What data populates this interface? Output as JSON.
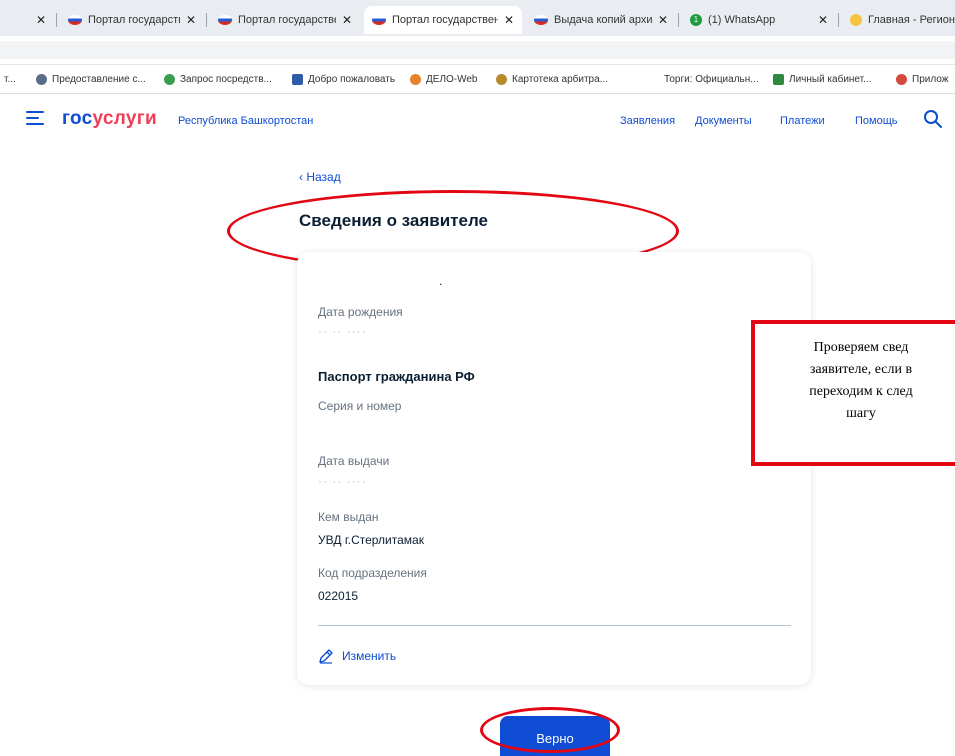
{
  "browser": {
    "tabs": [
      {
        "title": "",
        "icon": "tab-icon",
        "closable": true
      },
      {
        "title": "Портал государствен",
        "icon": "russian-flag-icon",
        "closable": true
      },
      {
        "title": "Портал государствен",
        "icon": "russian-flag-icon",
        "closable": true
      },
      {
        "title": "Портал государствен",
        "icon": "russian-flag-icon",
        "closable": true,
        "active": true
      },
      {
        "title": "Выдача копий архивн",
        "icon": "russian-flag-icon",
        "closable": true
      },
      {
        "title": "(1) WhatsApp",
        "icon": "whatsapp-icon",
        "closable": true
      },
      {
        "title": "Главная - Региона",
        "icon": "smile-icon",
        "closable": false
      }
    ],
    "bookmarks": [
      {
        "label": "т...",
        "icon": ""
      },
      {
        "label": "Предоставление с...",
        "icon": "globe-icon",
        "color": "#5b6b8a"
      },
      {
        "label": "Запрос посредств...",
        "icon": "leaf-icon",
        "color": "#3a9e52"
      },
      {
        "label": "Добро пожаловать",
        "icon": "bank-icon",
        "color": "#2f5aa8"
      },
      {
        "label": "ДЕЛО-Web",
        "icon": "delo-icon",
        "color": "#e3832a"
      },
      {
        "label": "Картотека арбитра...",
        "icon": "eagle-icon",
        "color": "#b88a2c"
      },
      {
        "label": "Торги: Официальн...",
        "icon": "",
        "color": ""
      },
      {
        "label": "Личный кабинет...",
        "icon": "m-icon",
        "color": "#2b8a3e"
      },
      {
        "label": "Прилож",
        "icon": "app-icon",
        "color": "#d34a3a"
      }
    ]
  },
  "header": {
    "logo_part1": "гос",
    "logo_part2": "услуги",
    "region": "Республика Башкортостан",
    "nav": [
      "Заявления",
      "Документы",
      "Платежи",
      "Помощь"
    ]
  },
  "page": {
    "back_label": "Назад",
    "back_prefix": "‹",
    "title": "Сведения о заявителе"
  },
  "card": {
    "dot": ".",
    "birth_label": "Дата рождения",
    "birth_value": "·· ·· ····",
    "passport_title": "Паспорт гражданина РФ",
    "series_label": "Серия и номер",
    "issue_date_label": "Дата выдачи",
    "issue_date_value": "·· ·· ····",
    "issued_by_label": "Кем выдан",
    "issued_by_value": "УВД г.Стерлитамак",
    "dept_code_label": "Код подразделения",
    "dept_code_value": "022015",
    "edit_label": "Изменить"
  },
  "annotation": {
    "lines": [
      "Проверяем свед",
      "заявителе, если в",
      "переходим к след",
      "шагу"
    ],
    "border_color": "#e30613"
  },
  "confirm_button": "Верно",
  "colors": {
    "brand_blue": "#0d4cd3",
    "brand_red": "#ee3f58",
    "annotation_red": "#e30613"
  }
}
